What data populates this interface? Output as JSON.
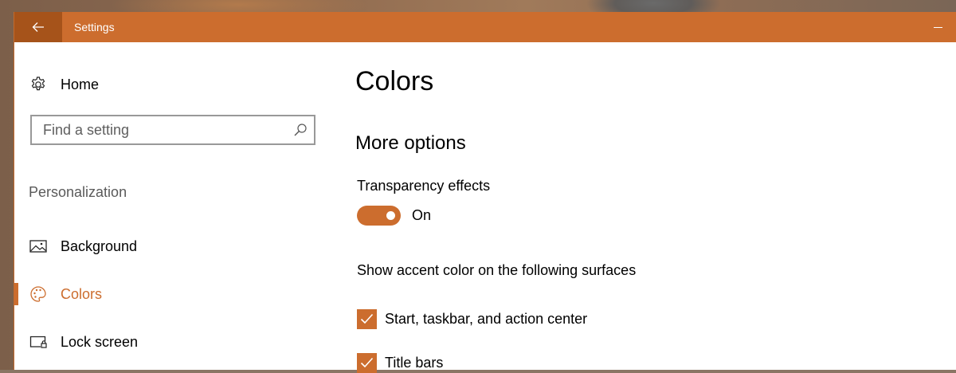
{
  "window": {
    "title": "Settings"
  },
  "sidebar": {
    "home_label": "Home",
    "search": {
      "placeholder": "Find a setting",
      "value": ""
    },
    "section_label": "Personalization",
    "items": [
      {
        "label": "Background",
        "icon": "picture-icon",
        "active": false
      },
      {
        "label": "Colors",
        "icon": "palette-icon",
        "active": true
      },
      {
        "label": "Lock screen",
        "icon": "lock-screen-icon",
        "active": false
      }
    ]
  },
  "main": {
    "title": "Colors",
    "subtitle": "More options",
    "transparency": {
      "label": "Transparency effects",
      "state": "On",
      "enabled": true
    },
    "accent_surfaces": {
      "label": "Show accent color on the following surfaces",
      "options": [
        {
          "label": "Start, taskbar, and action center",
          "checked": true
        },
        {
          "label": "Title bars",
          "checked": true
        }
      ]
    }
  },
  "colors": {
    "accent": "#cc6d2e",
    "accent_dark": "#a6531a"
  }
}
